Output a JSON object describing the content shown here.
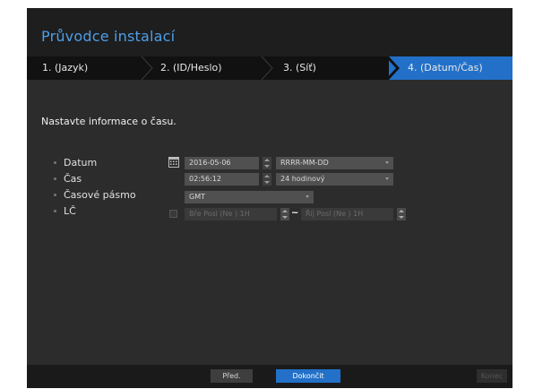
{
  "wizard": {
    "title": "Průvodce instalací",
    "steps": [
      {
        "label": "1.  (Jazyk)"
      },
      {
        "label": "2.  (ID/Heslo)"
      },
      {
        "label": "3.  (Síť)"
      },
      {
        "label": "4.  (Datum/Čas)"
      }
    ],
    "active_step": 4
  },
  "content": {
    "instruction": "Nastavte informace o času.",
    "date": {
      "label": "Datum",
      "value": "2016-05-06",
      "format": "RRRR-MM-DD"
    },
    "time": {
      "label": "Čas",
      "value": "02:56:12",
      "format": "24 hodinový"
    },
    "timezone": {
      "label": "Časové pásmo",
      "value": "GMT"
    },
    "dst": {
      "label": "LČ",
      "start": "Bře Posl (Ne ) 1H",
      "separator": "~",
      "end": "Říj Posl (Ne ) 1H"
    }
  },
  "footer": {
    "prev_label": "Před.",
    "finish_label": "Dokončit",
    "exit_label": "Konec"
  },
  "colors": {
    "accent": "#2270c8",
    "title": "#4d9ee8",
    "background": "#2c2c2c"
  }
}
